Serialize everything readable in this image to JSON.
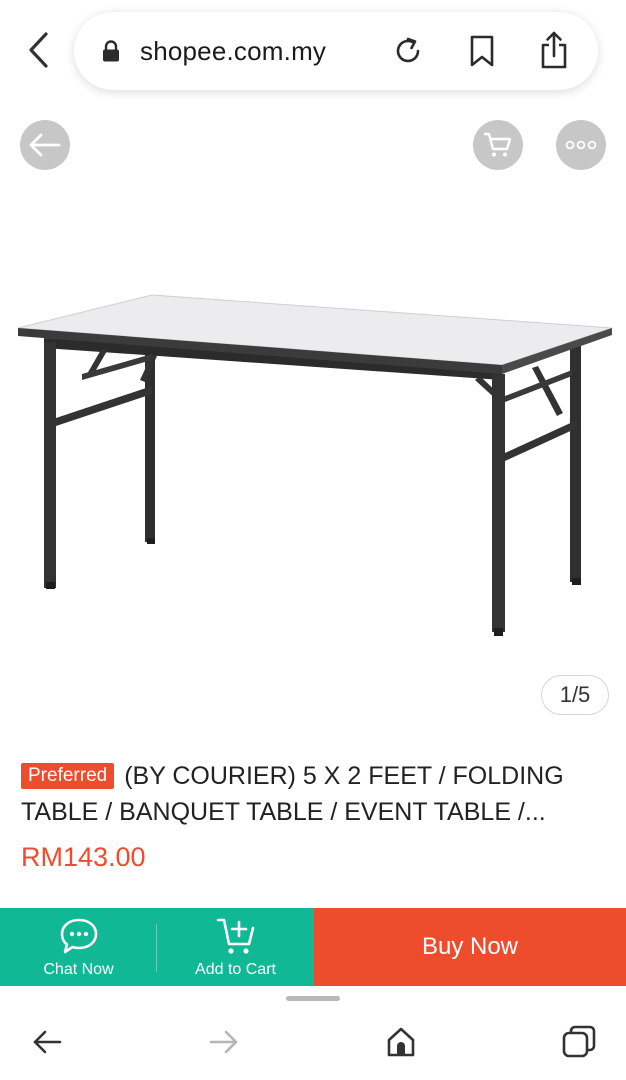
{
  "browser": {
    "url": "shopee.com.my",
    "icons": [
      "chevron-left-icon",
      "lock-icon",
      "reload-icon",
      "bookmark-icon",
      "share-icon"
    ]
  },
  "product": {
    "badge": "Preferred",
    "title": "(BY COURIER) 5 X 2 FEET / FOLDING TABLE / BANQUET TABLE / EVENT TABLE /...",
    "price": "RM143.00",
    "image_counter": "1/5"
  },
  "actions": {
    "chat_label": "Chat Now",
    "cart_label": "Add to Cart",
    "buy_label": "Buy Now"
  },
  "colors": {
    "brand_orange": "#ee4d2d",
    "action_green": "#11b895"
  },
  "bottom_nav": {
    "icons": [
      "back-arrow-icon",
      "forward-arrow-icon",
      "home-icon",
      "tabs-icon"
    ]
  }
}
